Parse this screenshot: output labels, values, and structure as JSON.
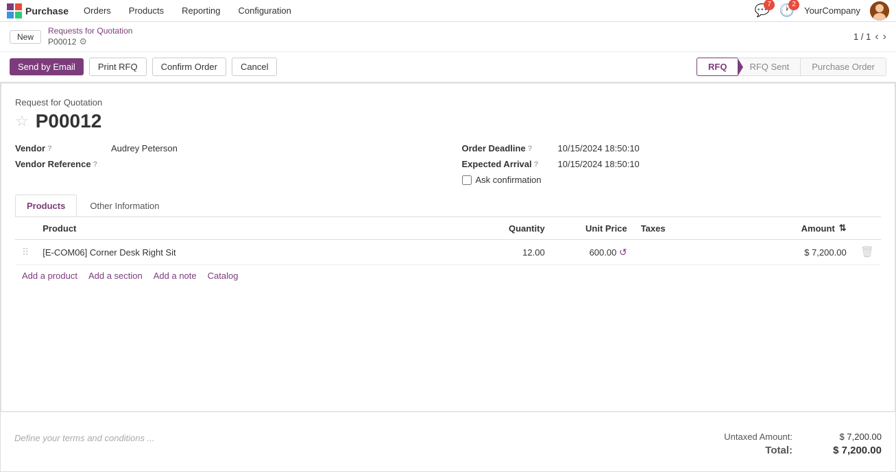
{
  "nav": {
    "logo_text": "Purchase",
    "items": [
      "Orders",
      "Products",
      "Reporting",
      "Configuration"
    ],
    "message_count": "7",
    "clock_count": "2",
    "company": "YourCompany"
  },
  "titlebar": {
    "new_label": "New",
    "breadcrumb_link": "Requests for Quotation",
    "current": "P00012",
    "pagination": "1 / 1"
  },
  "actions": {
    "send_email": "Send by Email",
    "print_rfq": "Print RFQ",
    "confirm_order": "Confirm Order",
    "cancel": "Cancel"
  },
  "status_steps": [
    {
      "label": "RFQ",
      "active": true
    },
    {
      "label": "RFQ Sent",
      "active": false
    },
    {
      "label": "Purchase Order",
      "active": false
    }
  ],
  "document": {
    "title_label": "Request for Quotation",
    "number": "P00012",
    "vendor_label": "Vendor",
    "vendor_value": "Audrey Peterson",
    "vendor_ref_label": "Vendor Reference",
    "order_deadline_label": "Order Deadline",
    "order_deadline_value": "10/15/2024 18:50:10",
    "expected_arrival_label": "Expected Arrival",
    "expected_arrival_value": "10/15/2024 18:50:10",
    "ask_confirmation_label": "Ask confirmation"
  },
  "tabs": [
    {
      "label": "Products",
      "active": true
    },
    {
      "label": "Other Information",
      "active": false
    }
  ],
  "table": {
    "headers": [
      "Product",
      "Quantity",
      "Unit Price",
      "Taxes",
      "Amount"
    ],
    "rows": [
      {
        "product": "[E-COM06] Corner Desk Right Sit",
        "quantity": "12.00",
        "unit_price": "600.00",
        "taxes": "",
        "amount": "$ 7,200.00"
      }
    ]
  },
  "add_links": [
    "Add a product",
    "Add a section",
    "Add a note",
    "Catalog"
  ],
  "footer": {
    "terms_placeholder": "Define your terms and conditions ...",
    "untaxed_label": "Untaxed Amount:",
    "untaxed_value": "$ 7,200.00",
    "total_label": "Total:",
    "total_value": "$ 7,200.00"
  }
}
